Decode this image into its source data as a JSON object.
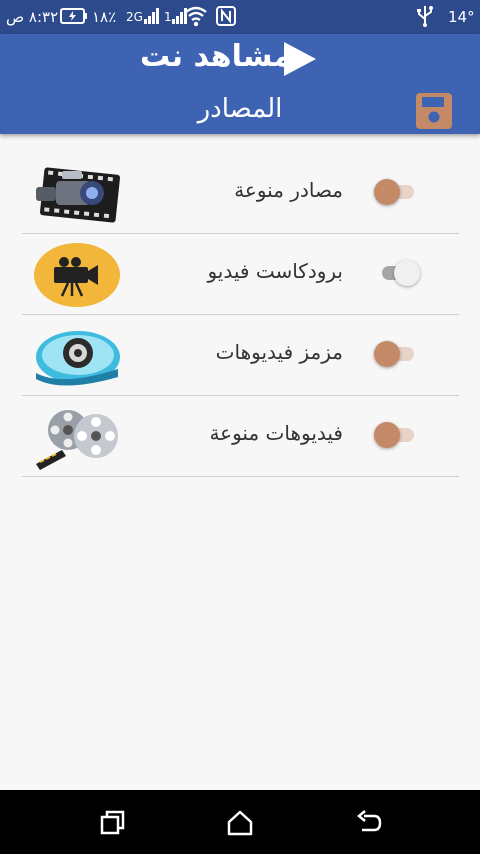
{
  "status_bar": {
    "time": "٨:٣٢ ص",
    "battery": "١٨٪",
    "signal_1": "2G",
    "signal_2": "1",
    "temperature": "14°"
  },
  "app_bar": {
    "logo_text": "مشاهد نت",
    "title": "المصادر",
    "accent_color": "#3f63b3"
  },
  "sources": [
    {
      "label": "مصادر منوعة",
      "enabled": false,
      "icon": "video-camera-film-icon"
    },
    {
      "label": "برودكاست فيديو",
      "enabled": true,
      "icon": "movie-camera-icon"
    },
    {
      "label": "مزمز فيديوهات",
      "enabled": false,
      "icon": "film-reel-player-icon"
    },
    {
      "label": "فيديوهات منوعة",
      "enabled": false,
      "icon": "film-reel-icon"
    }
  ],
  "nav_bar": {
    "buttons": [
      "recent-apps",
      "home",
      "back"
    ]
  }
}
